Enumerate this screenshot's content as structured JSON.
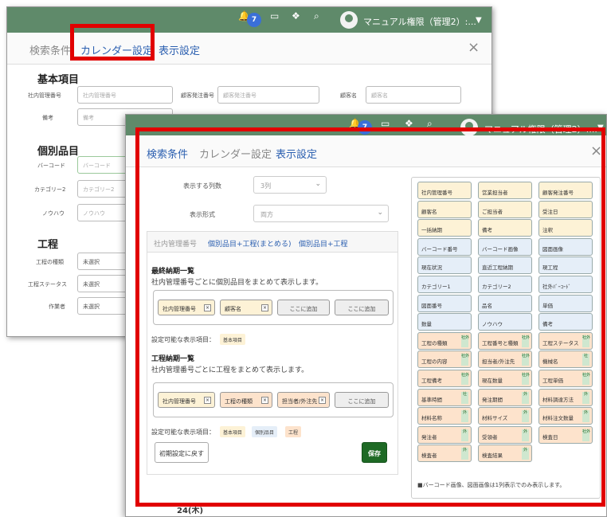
{
  "user": {
    "notification_count": "7",
    "name": "マニュアル権限（管理2）:..."
  },
  "tabs": {
    "search": "検索条件",
    "calendar": "カレンダー設定",
    "display": "表示設定"
  },
  "back": {
    "sec_basic": "基本項目",
    "f1_label": "社内管理番号",
    "f1_ph": "社内管理番号",
    "f2_label": "顧客発注番号",
    "f2_ph": "顧客発注番号",
    "f3_label": "顧客名",
    "f3_ph": "顧客名",
    "f4_label": "備考",
    "f4_ph": "備考",
    "sec_item": "個別品目",
    "f5_label": "バーコード",
    "f5_ph": "バーコード",
    "f6_label": "カテゴリー2",
    "f6_ph": "カテゴリー2",
    "f7_label": "ノウハウ",
    "f7_ph": "ノウハウ",
    "sec_process": "工程",
    "f8_label": "工程の種類",
    "f8_val": "未選択",
    "f9_label": "工程ステータス",
    "f9_val": "未選択",
    "f10_label": "作業者",
    "f10_val": "未選択"
  },
  "front": {
    "cols_label": "表示する列数",
    "cols_val": "3列",
    "format_label": "表示形式",
    "format_val": "両方",
    "subtabs": [
      "社内管理番号",
      "個別品目+工程(まとめる)",
      "個別品目+工程"
    ],
    "final_title": "最終納期一覧",
    "final_desc": "社内管理番号ごとに個別品目をまとめて表示します。",
    "final_slots": [
      "社内管理番号",
      "顧客名",
      "ここに追加",
      "ここに追加"
    ],
    "avail_label": "設定可能な表示項目：",
    "avail1": [
      "基本項目"
    ],
    "proc_title": "工程納期一覧",
    "proc_desc": "社内管理番号ごとに工程をまとめて表示します。",
    "proc_slots": [
      "社内管理番号",
      "工程の種類",
      "担当者/外注先",
      "ここに追加"
    ],
    "avail2": [
      "基本項目",
      "個別品目",
      "工程"
    ],
    "reset_btn": "初期設定に戻す",
    "save_btn": "保存",
    "fields": [
      {
        "label": "社内管理番号",
        "color": "beige",
        "badge": ""
      },
      {
        "label": "営業担当者",
        "color": "beige",
        "badge": ""
      },
      {
        "label": "顧客発注番号",
        "color": "beige",
        "badge": ""
      },
      {
        "label": "顧客名",
        "color": "beige",
        "badge": ""
      },
      {
        "label": "ご担当者",
        "color": "beige",
        "badge": ""
      },
      {
        "label": "受注日",
        "color": "beige",
        "badge": ""
      },
      {
        "label": "一括納期",
        "color": "beige",
        "badge": ""
      },
      {
        "label": "備考",
        "color": "beige",
        "badge": ""
      },
      {
        "label": "注釈",
        "color": "beige",
        "badge": ""
      },
      {
        "label": "バーコード番号",
        "color": "blue",
        "badge": ""
      },
      {
        "label": "バーコード画像",
        "color": "blue",
        "badge": ""
      },
      {
        "label": "図面画像",
        "color": "blue",
        "badge": ""
      },
      {
        "label": "現在状況",
        "color": "blue",
        "badge": ""
      },
      {
        "label": "直近工程納期",
        "color": "blue",
        "badge": ""
      },
      {
        "label": "現工程",
        "color": "blue",
        "badge": ""
      },
      {
        "label": "カテゴリー1",
        "color": "blue",
        "badge": ""
      },
      {
        "label": "カテゴリー2",
        "color": "blue",
        "badge": ""
      },
      {
        "label": "社外ﾊﾞｰｺｰﾄﾞ",
        "color": "blue",
        "badge": ""
      },
      {
        "label": "図面番号",
        "color": "blue",
        "badge": ""
      },
      {
        "label": "品名",
        "color": "blue",
        "badge": ""
      },
      {
        "label": "単価",
        "color": "blue",
        "badge": ""
      },
      {
        "label": "数量",
        "color": "blue",
        "badge": ""
      },
      {
        "label": "ノウハウ",
        "color": "blue",
        "badge": ""
      },
      {
        "label": "備考",
        "color": "blue",
        "badge": ""
      },
      {
        "label": "工程の種類",
        "color": "peach",
        "badge": "社外"
      },
      {
        "label": "工程番号と種類",
        "color": "peach",
        "badge": "社外"
      },
      {
        "label": "工程ステータス",
        "color": "peach",
        "badge": "社外"
      },
      {
        "label": "工程の内容",
        "color": "peach",
        "badge": "社外"
      },
      {
        "label": "担当者/外注先",
        "color": "peach",
        "badge": "社外"
      },
      {
        "label": "機械名",
        "color": "peach",
        "badge": "社"
      },
      {
        "label": "工程備考",
        "color": "peach",
        "badge": "社外"
      },
      {
        "label": "現在数量",
        "color": "peach",
        "badge": "社外"
      },
      {
        "label": "工程単価",
        "color": "peach",
        "badge": "社外"
      },
      {
        "label": "基準時間",
        "color": "peach",
        "badge": "社"
      },
      {
        "label": "発注期間",
        "color": "peach",
        "badge": "外"
      },
      {
        "label": "材料調達方法",
        "color": "peach",
        "badge": "外"
      },
      {
        "label": "材料名称",
        "color": "peach",
        "badge": "外"
      },
      {
        "label": "材料サイズ",
        "color": "peach",
        "badge": "外"
      },
      {
        "label": "材料注文数量",
        "color": "peach",
        "badge": "外"
      },
      {
        "label": "発注者",
        "color": "peach",
        "badge": "外"
      },
      {
        "label": "受領者",
        "color": "peach",
        "badge": "外"
      },
      {
        "label": "検査日",
        "color": "peach",
        "badge": "社外"
      },
      {
        "label": "検査者",
        "color": "peach",
        "badge": "外"
      },
      {
        "label": "検査結果",
        "color": "peach",
        "badge": "外"
      }
    ],
    "note": "■バーコード画像、図面画像は1列表示でのみ表示します。",
    "bottom_date": "24(木)"
  }
}
